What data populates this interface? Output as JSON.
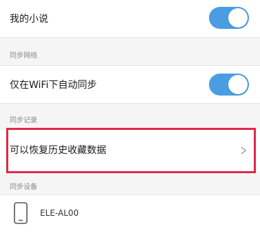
{
  "settings": {
    "my_novels": {
      "label": "我的小说",
      "toggle_on": true
    },
    "section_sync_network": "同步网络",
    "wifi_only": {
      "label": "仅在WiFi下自动同步",
      "toggle_on": true
    },
    "section_sync_records": "同步记录",
    "restore_history": {
      "label": "可以恢复历史收藏数据"
    },
    "section_sync_devices": "同步设备",
    "device": {
      "name": "ELE-AL00",
      "icon": "phone-icon"
    }
  },
  "colors": {
    "toggle_on": "#4a9de0",
    "highlight_border": "#e0284a"
  }
}
